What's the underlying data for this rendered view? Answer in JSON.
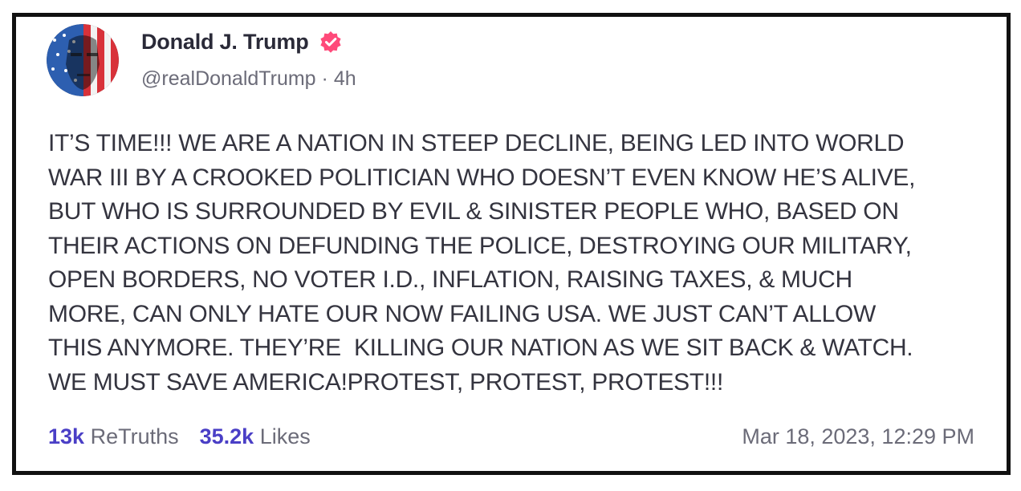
{
  "post": {
    "author_name": "Donald J. Trump",
    "handle": "@realDonaldTrump",
    "separator": " · ",
    "time_ago": "4h",
    "body": "IT’S TIME!!! WE ARE A NATION IN STEEP DECLINE, BEING LED INTO WORLD\nWAR III BY A CROOKED POLITICIAN WHO DOESN’T EVEN KNOW HE’S ALIVE,\nBUT WHO IS SURROUNDED BY EVIL & SINISTER PEOPLE WHO, BASED ON\nTHEIR ACTIONS ON DEFUNDING THE POLICE, DESTROYING OUR MILITARY,\nOPEN BORDERS, NO VOTER I.D., INFLATION, RAISING TAXES, & MUCH\nMORE, CAN ONLY HATE OUR NOW FAILING USA. WE JUST CAN’T ALLOW\nTHIS ANYMORE. THEY’RE  KILLING OUR NATION AS WE SIT BACK & WATCH.\nWE MUST SAVE AMERICA!PROTEST, PROTEST, PROTEST!!!",
    "retruths_count": "13k",
    "retruths_label": "ReTruths",
    "likes_count": "35.2k",
    "likes_label": "Likes",
    "timestamp": "Mar 18, 2023, 12:29 PM"
  },
  "icons": {
    "avatar": "avatar-image",
    "verified": "verified-badge-icon"
  },
  "colors": {
    "accent": "#4a3fc6",
    "verified": "#ff4a7a",
    "text": "#34343f",
    "muted": "#6b6b78",
    "border": "#111111"
  }
}
